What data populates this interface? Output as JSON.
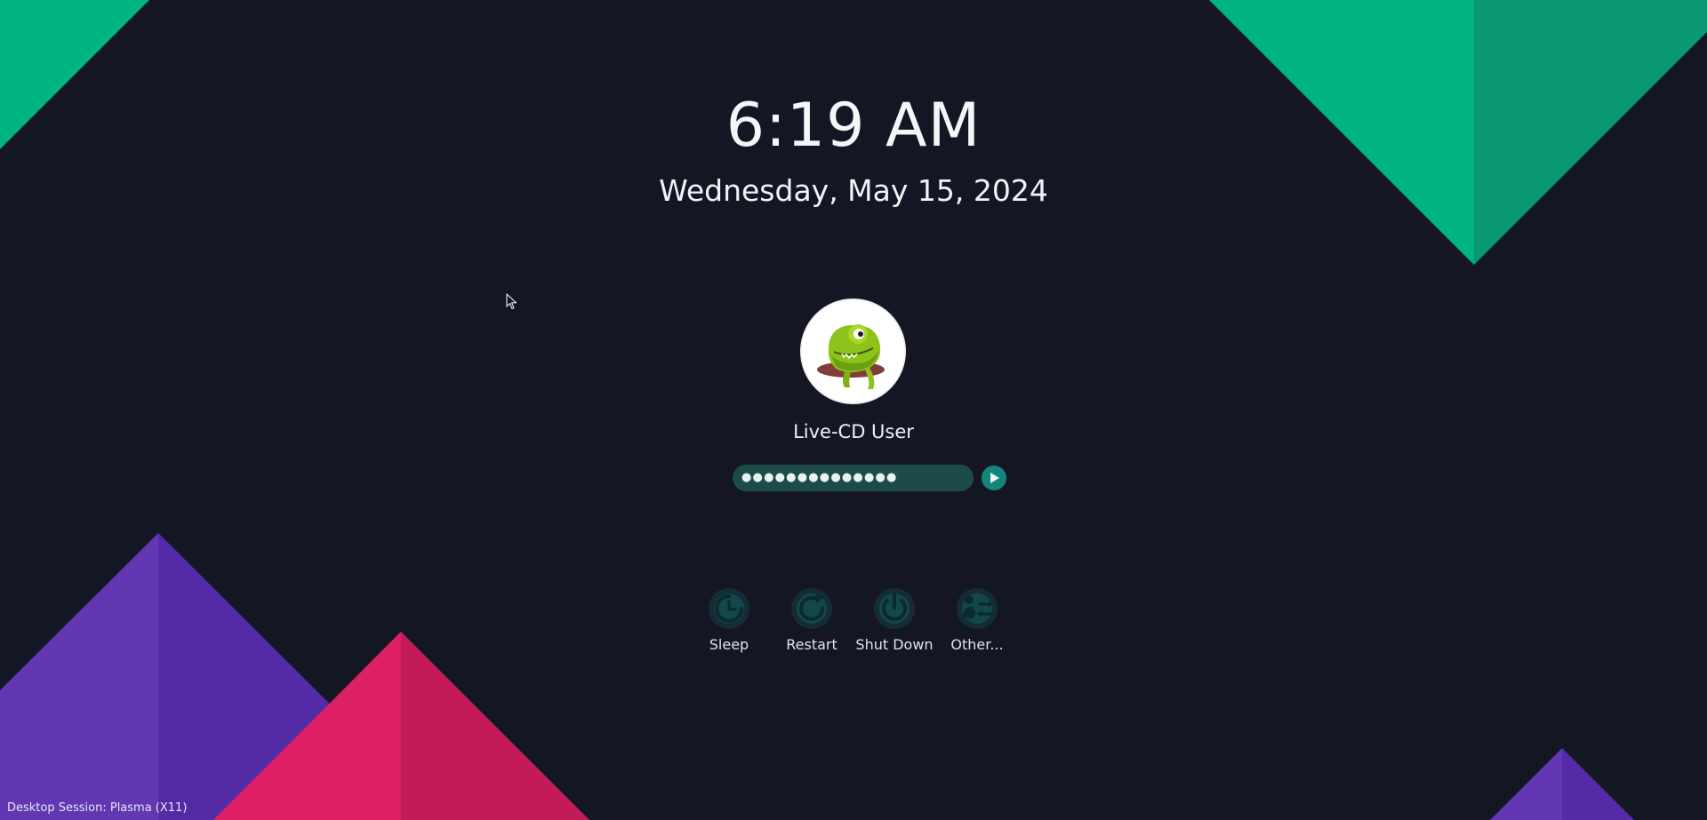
{
  "clock": {
    "time": "6:19 AM",
    "date": "Wednesday, May 15, 2024"
  },
  "user": {
    "name": "Live-CD User",
    "avatar_icon": "chameleon-avatar-icon"
  },
  "password": {
    "masked_value": "●●●●●●●●●●●●●●",
    "login_icon": "play-arrow-icon"
  },
  "actions": [
    {
      "label": "Sleep",
      "icon": "sleep-icon"
    },
    {
      "label": "Restart",
      "icon": "restart-icon"
    },
    {
      "label": "Shut Down",
      "icon": "shutdown-icon"
    },
    {
      "label": "Other...",
      "icon": "switch-user-icon"
    }
  ],
  "session": {
    "label": "Desktop Session: Plasma (X11)"
  },
  "colors": {
    "background": "#141723",
    "green": "#00b482",
    "dark_green": "#0a9870",
    "purple": "#6336b2",
    "dark_purple": "#552aa6",
    "pink": "#dd1f63",
    "dark_pink": "#c31b58",
    "field": "#1d4b48",
    "accent": "#14857a"
  }
}
